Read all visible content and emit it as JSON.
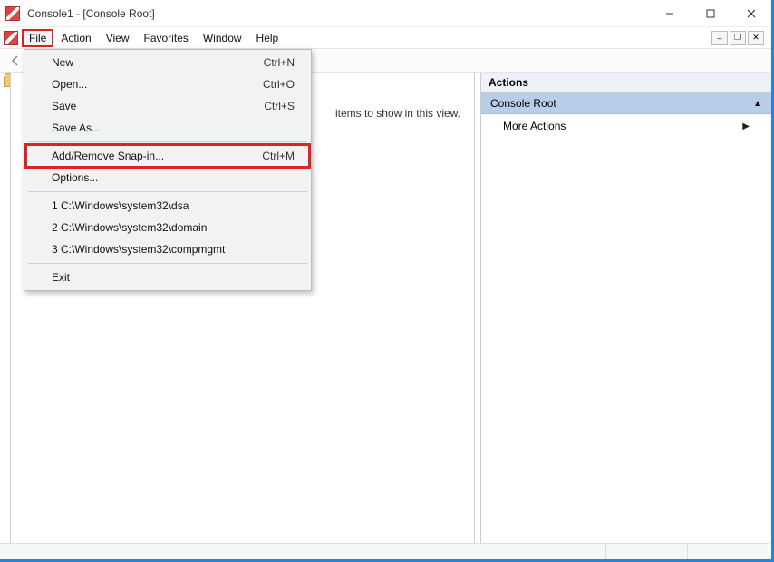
{
  "titlebar": {
    "title": "Console1 - [Console Root]"
  },
  "menubar": {
    "file": "File",
    "action": "Action",
    "view": "View",
    "favorites": "Favorites",
    "window": "Window",
    "help": "Help"
  },
  "dropdown": {
    "new": {
      "label": "New",
      "shortcut": "Ctrl+N"
    },
    "open": {
      "label": "Open...",
      "shortcut": "Ctrl+O"
    },
    "save": {
      "label": "Save",
      "shortcut": "Ctrl+S"
    },
    "saveas": {
      "label": "Save As..."
    },
    "addremove": {
      "label": "Add/Remove Snap-in...",
      "shortcut": "Ctrl+M"
    },
    "options": {
      "label": "Options..."
    },
    "recent1": {
      "label": "1 C:\\Windows\\system32\\dsa"
    },
    "recent2": {
      "label": "2 C:\\Windows\\system32\\domain"
    },
    "recent3": {
      "label": "3 C:\\Windows\\system32\\compmgmt"
    },
    "exit": {
      "label": "Exit"
    }
  },
  "center": {
    "empty_text": "items to show in this view."
  },
  "actions": {
    "header": "Actions",
    "section_title": "Console Root",
    "more_actions": "More Actions"
  }
}
